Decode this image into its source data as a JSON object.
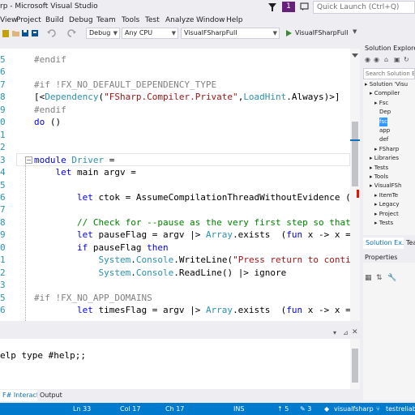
{
  "window": {
    "title": "rp - Microsoft Visual Studio",
    "notifications_count": "1",
    "quick_launch_placeholder": "Quick Launch (Ctrl+Q)"
  },
  "menu": [
    "View",
    "Project",
    "Build",
    "Debug",
    "Team",
    "Tools",
    "Test",
    "Analyze",
    "Window",
    "Help"
  ],
  "toolbar": {
    "configuration": "Debug",
    "platform": "Any CPU",
    "startup_project": "VisualFSharpFull",
    "start_label": "VisualFSharpFull"
  },
  "editor": {
    "lines": [
      {
        "num": "5",
        "segments": [
          {
            "t": "#endif",
            "c": "pp"
          }
        ]
      },
      {
        "num": "6",
        "segments": []
      },
      {
        "num": "7",
        "segments": [
          {
            "t": "#if !FX_NO_DEFAULT_DEPENDENCY_TYPE",
            "c": "pp"
          }
        ]
      },
      {
        "num": "8",
        "segments": [
          {
            "t": "[<",
            "c": ""
          },
          {
            "t": "Dependency",
            "c": "ty"
          },
          {
            "t": "(",
            "c": ""
          },
          {
            "t": "\"FSharp.Compiler.Private\"",
            "c": "str"
          },
          {
            "t": ",",
            "c": ""
          },
          {
            "t": "LoadHint",
            "c": "ty"
          },
          {
            "t": ".Always)>]",
            "c": ""
          }
        ]
      },
      {
        "num": "9",
        "segments": [
          {
            "t": "#endif",
            "c": "pp"
          }
        ]
      },
      {
        "num": "0",
        "segments": [
          {
            "t": "do",
            "c": "kw"
          },
          {
            "t": " ()",
            "c": ""
          }
        ]
      },
      {
        "num": "1",
        "segments": []
      },
      {
        "num": "2",
        "segments": []
      },
      {
        "num": "3",
        "segments": [
          {
            "t": "module",
            "c": "kw"
          },
          {
            "t": " ",
            "c": ""
          },
          {
            "t": "Driver",
            "c": "ty"
          },
          {
            "t": " =",
            "c": ""
          }
        ]
      },
      {
        "num": "4",
        "segments": [
          {
            "t": "    ",
            "c": ""
          },
          {
            "t": "let",
            "c": "kw"
          },
          {
            "t": " main argv =",
            "c": ""
          }
        ]
      },
      {
        "num": "5",
        "segments": []
      },
      {
        "num": "6",
        "segments": [
          {
            "t": "        ",
            "c": ""
          },
          {
            "t": "let",
            "c": "kw"
          },
          {
            "t": " ctok = AssumeCompilationThreadWithoutEvidence ()",
            "c": ""
          }
        ]
      },
      {
        "num": "7",
        "segments": []
      },
      {
        "num": "8",
        "segments": [
          {
            "t": "        // Check for --pause as the very first step so that",
            "c": "cm"
          }
        ]
      },
      {
        "num": "9",
        "segments": [
          {
            "t": "        ",
            "c": ""
          },
          {
            "t": "let",
            "c": "kw"
          },
          {
            "t": " pauseFlag = argv |> ",
            "c": ""
          },
          {
            "t": "Array",
            "c": "ty"
          },
          {
            "t": ".exists  (",
            "c": ""
          },
          {
            "t": "fun",
            "c": "kw"
          },
          {
            "t": " x -> x =",
            "c": ""
          }
        ]
      },
      {
        "num": "0",
        "segments": [
          {
            "t": "        ",
            "c": ""
          },
          {
            "t": "if",
            "c": "kw"
          },
          {
            "t": " pauseFlag ",
            "c": ""
          },
          {
            "t": "then",
            "c": "kw"
          }
        ]
      },
      {
        "num": "1",
        "segments": [
          {
            "t": "            ",
            "c": ""
          },
          {
            "t": "System",
            "c": "ty"
          },
          {
            "t": ".",
            "c": ""
          },
          {
            "t": "Console",
            "c": "ty"
          },
          {
            "t": ".WriteLine(",
            "c": ""
          },
          {
            "t": "\"Press return to contir",
            "c": "str"
          }
        ]
      },
      {
        "num": "2",
        "segments": [
          {
            "t": "            ",
            "c": ""
          },
          {
            "t": "System",
            "c": "ty"
          },
          {
            "t": ".",
            "c": ""
          },
          {
            "t": "Console",
            "c": "ty"
          },
          {
            "t": ".ReadLine() |> ignore",
            "c": ""
          }
        ]
      },
      {
        "num": "3",
        "segments": []
      },
      {
        "num": "5",
        "segments": [
          {
            "t": "#if !FX_NO_APP_DOMAINS",
            "c": "pp"
          }
        ]
      },
      {
        "num": "6",
        "segments": [
          {
            "t": "        ",
            "c": ""
          },
          {
            "t": "let",
            "c": "kw"
          },
          {
            "t": " timesFlag = argv |> ",
            "c": ""
          },
          {
            "t": "Array",
            "c": "ty"
          },
          {
            "t": ".exists  (",
            "c": ""
          },
          {
            "t": "fun",
            "c": "kw"
          },
          {
            "t": " x -> x =",
            "c": ""
          }
        ]
      }
    ]
  },
  "interactive": {
    "text": "elp type #help;;",
    "tabs": [
      "F# Interactive",
      "Output"
    ]
  },
  "solution_explorer": {
    "title": "Solution Explorer",
    "search_placeholder": "Search Solution Expl",
    "items": [
      {
        "label": "Solution 'Visu",
        "indent": 0,
        "selected": false
      },
      {
        "label": "Compiler",
        "indent": 1,
        "selected": false
      },
      {
        "label": "Fsc",
        "indent": 2,
        "selected": false
      },
      {
        "label": "Dep",
        "indent": 3,
        "selected": false
      },
      {
        "label": "fsc",
        "indent": 3,
        "selected": true
      },
      {
        "label": "app",
        "indent": 3,
        "selected": false
      },
      {
        "label": "def",
        "indent": 3,
        "selected": false
      },
      {
        "label": "FSharp",
        "indent": 2,
        "selected": false
      },
      {
        "label": "Libraries",
        "indent": 1,
        "selected": false
      },
      {
        "label": "Tests",
        "indent": 1,
        "selected": false
      },
      {
        "label": "Tools",
        "indent": 1,
        "selected": false
      },
      {
        "label": "VisualFSh",
        "indent": 1,
        "selected": false
      },
      {
        "label": "ItemTe",
        "indent": 2,
        "selected": false
      },
      {
        "label": "Legacy",
        "indent": 2,
        "selected": false
      },
      {
        "label": "Project",
        "indent": 2,
        "selected": false
      },
      {
        "label": "Tests",
        "indent": 2,
        "selected": false
      }
    ],
    "tabs": [
      "Solution Ex...",
      "Team..."
    ]
  },
  "properties": {
    "title": "Properties"
  },
  "statusbar": {
    "line": "Ln 33",
    "col": "Col 17",
    "ch": "Ch 17",
    "mode": "INS",
    "up": "↑ 5",
    "pencil": "✎ 3",
    "repo": "visualfsharp",
    "branch": "testreliab"
  },
  "colors": {
    "accent": "#007acc",
    "selection": "#3399ff",
    "vs_purple": "#68217a"
  }
}
